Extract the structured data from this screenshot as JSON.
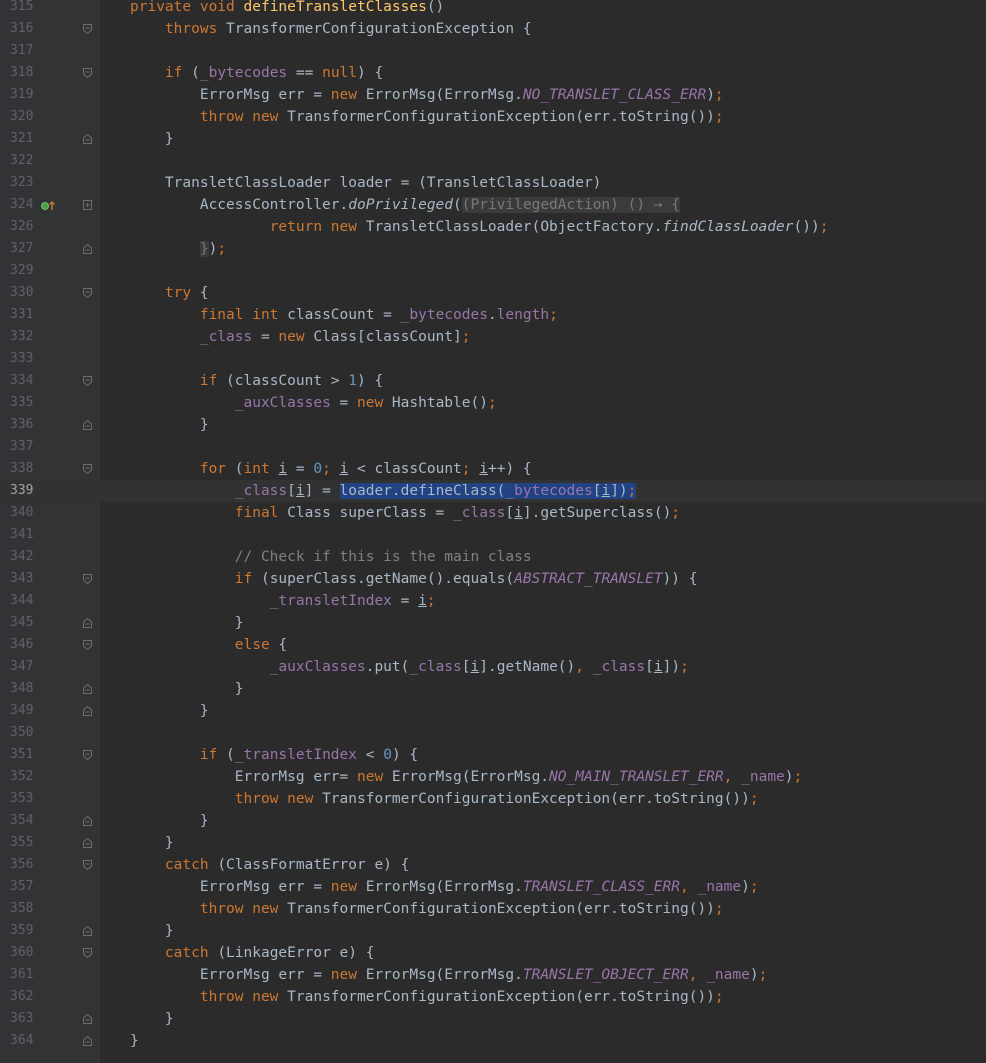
{
  "editor": {
    "lines": [
      {
        "n": "315",
        "html": "<span class=\"k\">private void </span><span class=\"fn\">defineTransletClasses</span>()",
        "fold": "none"
      },
      {
        "n": "316",
        "html": "    <span class=\"k\">throws </span>TransformerConfigurationException {",
        "fold": "open"
      },
      {
        "n": "317",
        "html": "",
        "fold": "none"
      },
      {
        "n": "318",
        "html": "    <span class=\"k\">if </span>(<span class=\"fld\">_bytecodes</span> == <span class=\"k\">null</span>) {",
        "fold": "open"
      },
      {
        "n": "319",
        "html": "        ErrorMsg err = <span class=\"k\">new </span>ErrorMsg(ErrorMsg.<span class=\"st\">NO_TRANSLET_CLASS_ERR</span>)<span class=\"k\">;</span>",
        "fold": "none"
      },
      {
        "n": "320",
        "html": "        <span class=\"k\">throw new </span>TransformerConfigurationException(err.toString())<span class=\"k\">;</span>",
        "fold": "none"
      },
      {
        "n": "321",
        "html": "    }",
        "fold": "close"
      },
      {
        "n": "322",
        "html": "",
        "fold": "none"
      },
      {
        "n": "323",
        "html": "    TransletClassLoader loader = (TransletClassLoader)",
        "fold": "none"
      },
      {
        "n": "324",
        "html": "        AccessController.<span class=\"fi\">doPrivileged</span>(<span class=\"hint\">(PrivilegedAction) () → {</span>",
        "fold": "plus",
        "icon": true
      },
      {
        "n": "326",
        "html": "                <span class=\"k\">return new </span>TransletClassLoader(ObjectFactory.<span class=\"fi\">findClassLoader</span>())<span class=\"k\">;</span>",
        "fold": "none"
      },
      {
        "n": "327",
        "html": "        <span class=\"hint\">}</span>)<span class=\"k\">;</span>",
        "fold": "close"
      },
      {
        "n": "329",
        "html": "",
        "fold": "none"
      },
      {
        "n": "330",
        "html": "    <span class=\"k\">try </span>{",
        "fold": "open"
      },
      {
        "n": "331",
        "html": "        <span class=\"k\">final int </span>classCount = <span class=\"fld\">_bytecodes</span>.<span class=\"fld\">length</span><span class=\"k\">;</span>",
        "fold": "none"
      },
      {
        "n": "332",
        "html": "        <span class=\"fld\">_class </span>= <span class=\"k\">new </span>Class[classCount]<span class=\"k\">;</span>",
        "fold": "none"
      },
      {
        "n": "333",
        "html": "",
        "fold": "none"
      },
      {
        "n": "334",
        "html": "        <span class=\"k\">if </span>(classCount > <span class=\"num\">1</span>) {",
        "fold": "open"
      },
      {
        "n": "335",
        "html": "            <span class=\"fld\">_auxClasses </span>= <span class=\"k\">new </span>Hashtable()<span class=\"k\">;</span>",
        "fold": "none"
      },
      {
        "n": "336",
        "html": "        }",
        "fold": "close"
      },
      {
        "n": "337",
        "html": "",
        "fold": "none"
      },
      {
        "n": "338",
        "html": "        <span class=\"k\">for </span>(<span class=\"k\">int </span><span class=\"u\">i</span> = <span class=\"num\">0</span><span class=\"k\">; </span><span class=\"u\">i</span> < classCount<span class=\"k\">; </span><span class=\"u\">i</span>++) {",
        "fold": "open"
      },
      {
        "n": "339",
        "html": "            <span class=\"fld\">_class</span>[<span class=\"u\">i</span>] = <span class=\"sel\">loader.defineClass(<span class=\"fld\">_bytecodes</span>[<span class=\"u\">i</span>])<span class=\"k\">;</span></span>",
        "fold": "none",
        "current": true
      },
      {
        "n": "340",
        "html": "            <span class=\"k\">final </span>Class superClass = <span class=\"fld\">_class</span>[<span class=\"u\">i</span>].getSuperclass()<span class=\"k\">;</span>",
        "fold": "none"
      },
      {
        "n": "341",
        "html": "",
        "fold": "none"
      },
      {
        "n": "342",
        "html": "            <span class=\"cm\">// Check if this is the main class</span>",
        "fold": "none"
      },
      {
        "n": "343",
        "html": "            <span class=\"k\">if </span>(superClass.getName().equals(<span class=\"st\">ABSTRACT_TRANSLET</span>)) {",
        "fold": "open"
      },
      {
        "n": "344",
        "html": "                <span class=\"fld\">_transletIndex </span>= <span class=\"u\">i</span><span class=\"k\">;</span>",
        "fold": "none"
      },
      {
        "n": "345",
        "html": "            }",
        "fold": "close"
      },
      {
        "n": "346",
        "html": "            <span class=\"k\">else </span>{",
        "fold": "open"
      },
      {
        "n": "347",
        "html": "                <span class=\"fld\">_auxClasses</span>.put(<span class=\"fld\">_class</span>[<span class=\"u\">i</span>].getName()<span class=\"k\">, </span><span class=\"fld\">_class</span>[<span class=\"u\">i</span>])<span class=\"k\">;</span>",
        "fold": "none"
      },
      {
        "n": "348",
        "html": "            }",
        "fold": "close"
      },
      {
        "n": "349",
        "html": "        }",
        "fold": "close"
      },
      {
        "n": "350",
        "html": "",
        "fold": "none"
      },
      {
        "n": "351",
        "html": "        <span class=\"k\">if </span>(<span class=\"fld\">_transletIndex </span>< <span class=\"num\">0</span>) {",
        "fold": "open"
      },
      {
        "n": "352",
        "html": "            ErrorMsg err= <span class=\"k\">new </span>ErrorMsg(ErrorMsg.<span class=\"st\">NO_MAIN_TRANSLET_ERR</span><span class=\"k\">, </span><span class=\"fld\">_name</span>)<span class=\"k\">;</span>",
        "fold": "none"
      },
      {
        "n": "353",
        "html": "            <span class=\"k\">throw new </span>TransformerConfigurationException(err.toString())<span class=\"k\">;</span>",
        "fold": "none"
      },
      {
        "n": "354",
        "html": "        }",
        "fold": "close"
      },
      {
        "n": "355",
        "html": "    }",
        "fold": "close"
      },
      {
        "n": "356",
        "html": "    <span class=\"k\">catch </span>(ClassFormatError e) {",
        "fold": "open"
      },
      {
        "n": "357",
        "html": "        ErrorMsg err = <span class=\"k\">new </span>ErrorMsg(ErrorMsg.<span class=\"st\">TRANSLET_CLASS_ERR</span><span class=\"k\">, </span><span class=\"fld\">_name</span>)<span class=\"k\">;</span>",
        "fold": "none"
      },
      {
        "n": "358",
        "html": "        <span class=\"k\">throw new </span>TransformerConfigurationException(err.toString())<span class=\"k\">;</span>",
        "fold": "none"
      },
      {
        "n": "359",
        "html": "    }",
        "fold": "close"
      },
      {
        "n": "360",
        "html": "    <span class=\"k\">catch </span>(LinkageError e) {",
        "fold": "open"
      },
      {
        "n": "361",
        "html": "        ErrorMsg err = <span class=\"k\">new </span>ErrorMsg(ErrorMsg.<span class=\"st\">TRANSLET_OBJECT_ERR</span><span class=\"k\">, </span><span class=\"fld\">_name</span>)<span class=\"k\">;</span>",
        "fold": "none"
      },
      {
        "n": "362",
        "html": "        <span class=\"k\">throw new </span>TransformerConfigurationException(err.toString())<span class=\"k\">;</span>",
        "fold": "none"
      },
      {
        "n": "363",
        "html": "    }",
        "fold": "close"
      },
      {
        "n": "364",
        "html": "}",
        "fold": "close"
      }
    ]
  },
  "theme": {
    "background": "#2b2b2b",
    "gutter": "#313335",
    "keyword": "#cc7832",
    "method_decl": "#ffc66d",
    "field": "#9876aa",
    "number": "#6897bb",
    "comment": "#808080",
    "selection": "#214283"
  }
}
